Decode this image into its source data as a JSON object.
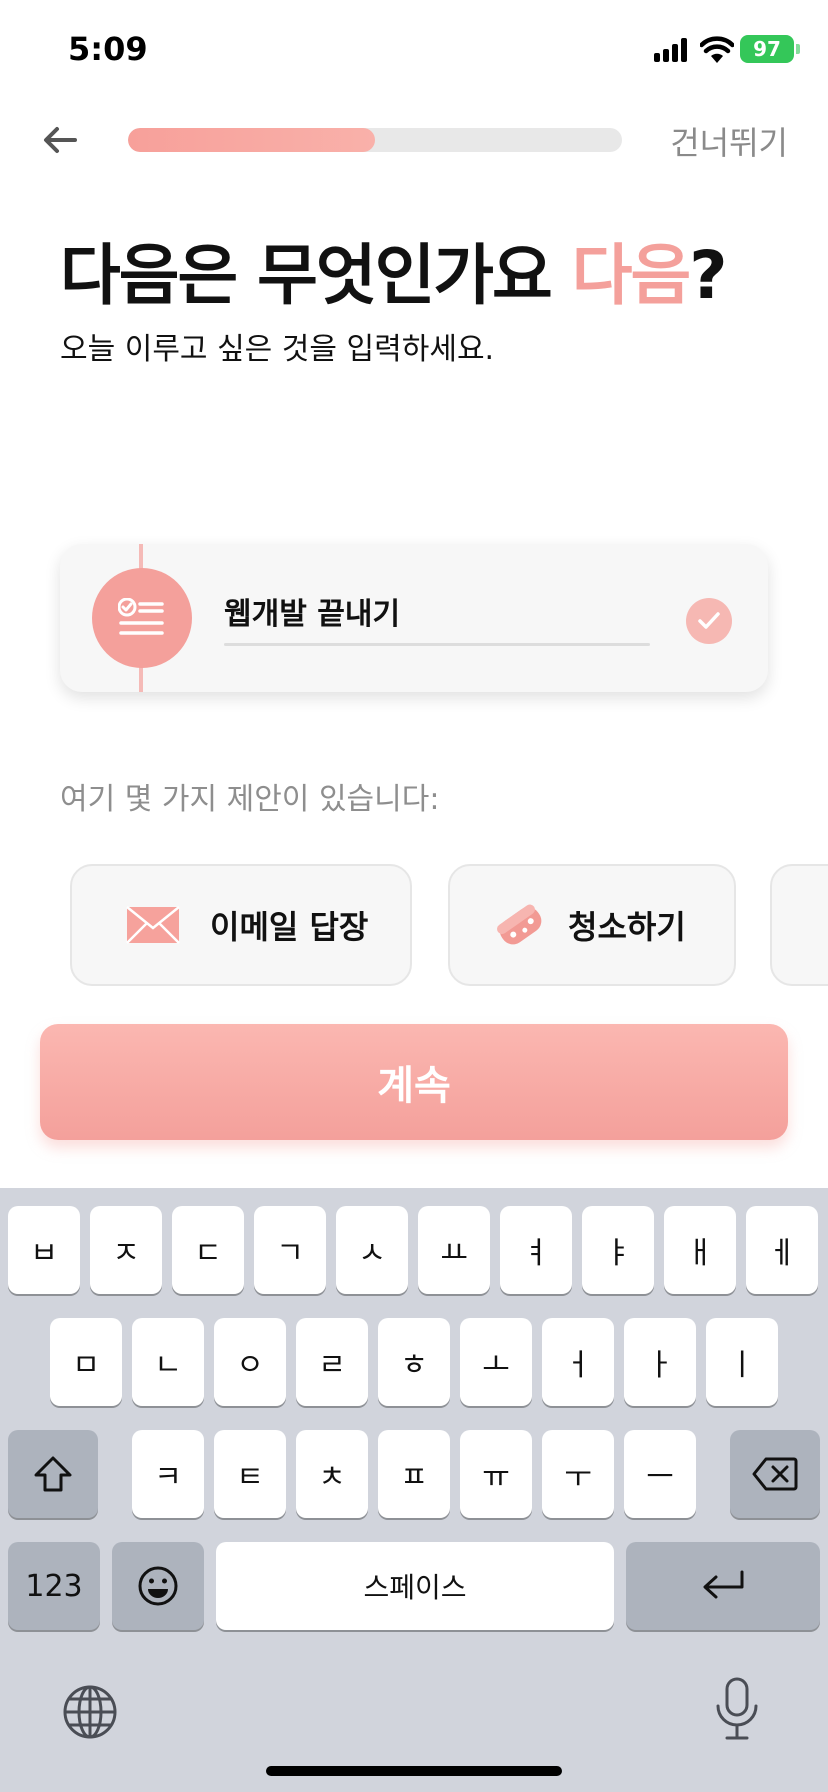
{
  "status_bar": {
    "time": "5:09",
    "battery": "97"
  },
  "nav": {
    "progress": 0.5,
    "skip_label": "건너뛰기"
  },
  "heading": {
    "title": "다음은 무엇인가요",
    "title_accent": "다음",
    "title_end": "?",
    "subtitle": "오늘 이루고 싶은 것을 입력하세요."
  },
  "task_card": {
    "input_value": "웹개발 끝내기"
  },
  "suggestions": {
    "label": "여기 몇 가지 제안이 있습니다:",
    "chips": [
      {
        "label": "이메일 답장",
        "icon": "envelope-icon"
      },
      {
        "label": "청소하기",
        "icon": "sponge-icon"
      },
      {
        "label": "",
        "icon": "partial-chip-icon"
      }
    ]
  },
  "continue_label": "계속",
  "keyboard": {
    "row1": [
      "ㅂ",
      "ㅈ",
      "ㄷ",
      "ㄱ",
      "ㅅ",
      "ㅛ",
      "ㅕ",
      "ㅑ",
      "ㅐ",
      "ㅔ"
    ],
    "row2": [
      "ㅁ",
      "ㄴ",
      "ㅇ",
      "ㄹ",
      "ㅎ",
      "ㅗ",
      "ㅓ",
      "ㅏ",
      "ㅣ"
    ],
    "row3": [
      "ㅋ",
      "ㅌ",
      "ㅊ",
      "ㅍ",
      "ㅠ",
      "ㅜ",
      "ㅡ"
    ],
    "numbers_label": "123",
    "space_label": "스페이스"
  },
  "colors": {
    "accent": "#f4a09b",
    "keyboard_bg": "#d1d4dc"
  }
}
